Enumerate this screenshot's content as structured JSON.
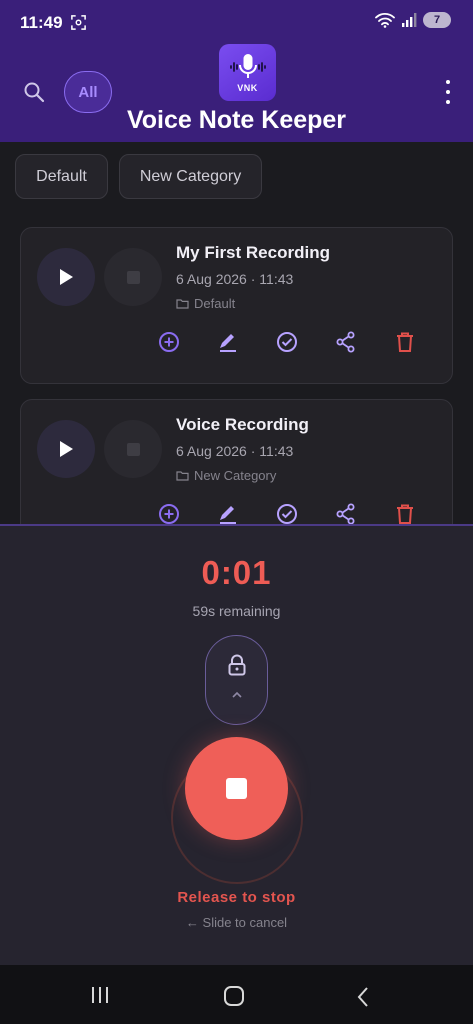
{
  "status_bar": {
    "time": "11:49",
    "battery": "7"
  },
  "header": {
    "filter_chip": "All",
    "logo_text": "VNK",
    "title": "Voice Note Keeper",
    "icons": {
      "search": "search-icon",
      "menu": "more-vert-icon",
      "logo": "microphone-icon"
    }
  },
  "categories": [
    {
      "label": "Default"
    },
    {
      "label": "New Category"
    }
  ],
  "recordings": [
    {
      "title": "My First Recording",
      "date": "6 Aug 2026 · 11:43",
      "category": "Default"
    },
    {
      "title": "Voice Recording",
      "date": "6 Aug 2026 · 11:43",
      "category": "New Category"
    }
  ],
  "card_actions": [
    "add-circle-icon",
    "edit-icon",
    "check-circle-icon",
    "share-icon",
    "delete-icon"
  ],
  "recorder": {
    "timer": "0:01",
    "remaining": "59s remaining",
    "release_hint": "Release to stop",
    "cancel_hint": "← Slide to cancel"
  },
  "colors": {
    "header_bg": "#3a1f7a",
    "accent": "#8a6cf0",
    "record_red": "#ef5f58",
    "delete_red": "#e0504b"
  }
}
